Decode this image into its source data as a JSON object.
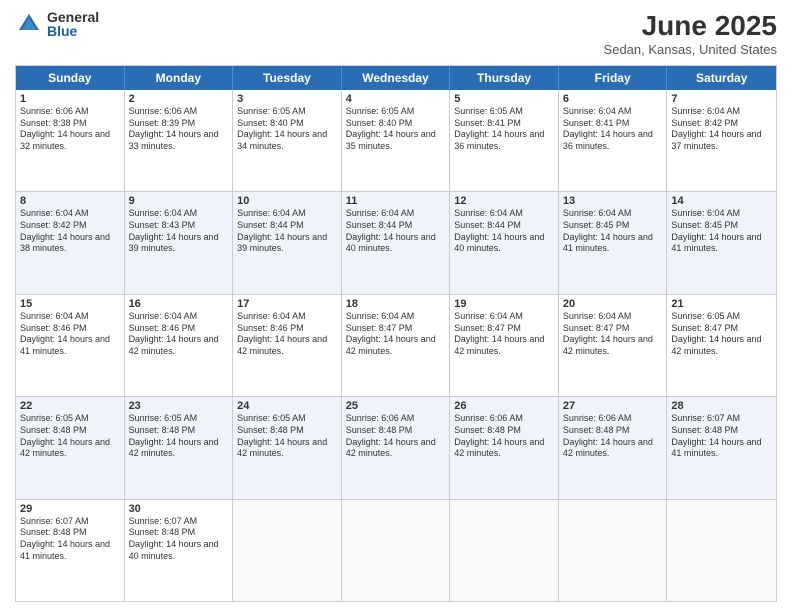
{
  "logo": {
    "general": "General",
    "blue": "Blue"
  },
  "title": "June 2025",
  "location": "Sedan, Kansas, United States",
  "weekdays": [
    "Sunday",
    "Monday",
    "Tuesday",
    "Wednesday",
    "Thursday",
    "Friday",
    "Saturday"
  ],
  "rows": [
    {
      "alt": false,
      "cells": [
        {
          "day": "1",
          "sunrise": "Sunrise: 6:06 AM",
          "sunset": "Sunset: 8:38 PM",
          "daylight": "Daylight: 14 hours and 32 minutes."
        },
        {
          "day": "2",
          "sunrise": "Sunrise: 6:06 AM",
          "sunset": "Sunset: 8:39 PM",
          "daylight": "Daylight: 14 hours and 33 minutes."
        },
        {
          "day": "3",
          "sunrise": "Sunrise: 6:05 AM",
          "sunset": "Sunset: 8:40 PM",
          "daylight": "Daylight: 14 hours and 34 minutes."
        },
        {
          "day": "4",
          "sunrise": "Sunrise: 6:05 AM",
          "sunset": "Sunset: 8:40 PM",
          "daylight": "Daylight: 14 hours and 35 minutes."
        },
        {
          "day": "5",
          "sunrise": "Sunrise: 6:05 AM",
          "sunset": "Sunset: 8:41 PM",
          "daylight": "Daylight: 14 hours and 36 minutes."
        },
        {
          "day": "6",
          "sunrise": "Sunrise: 6:04 AM",
          "sunset": "Sunset: 8:41 PM",
          "daylight": "Daylight: 14 hours and 36 minutes."
        },
        {
          "day": "7",
          "sunrise": "Sunrise: 6:04 AM",
          "sunset": "Sunset: 8:42 PM",
          "daylight": "Daylight: 14 hours and 37 minutes."
        }
      ]
    },
    {
      "alt": true,
      "cells": [
        {
          "day": "8",
          "sunrise": "Sunrise: 6:04 AM",
          "sunset": "Sunset: 8:42 PM",
          "daylight": "Daylight: 14 hours and 38 minutes."
        },
        {
          "day": "9",
          "sunrise": "Sunrise: 6:04 AM",
          "sunset": "Sunset: 8:43 PM",
          "daylight": "Daylight: 14 hours and 39 minutes."
        },
        {
          "day": "10",
          "sunrise": "Sunrise: 6:04 AM",
          "sunset": "Sunset: 8:44 PM",
          "daylight": "Daylight: 14 hours and 39 minutes."
        },
        {
          "day": "11",
          "sunrise": "Sunrise: 6:04 AM",
          "sunset": "Sunset: 8:44 PM",
          "daylight": "Daylight: 14 hours and 40 minutes."
        },
        {
          "day": "12",
          "sunrise": "Sunrise: 6:04 AM",
          "sunset": "Sunset: 8:44 PM",
          "daylight": "Daylight: 14 hours and 40 minutes."
        },
        {
          "day": "13",
          "sunrise": "Sunrise: 6:04 AM",
          "sunset": "Sunset: 8:45 PM",
          "daylight": "Daylight: 14 hours and 41 minutes."
        },
        {
          "day": "14",
          "sunrise": "Sunrise: 6:04 AM",
          "sunset": "Sunset: 8:45 PM",
          "daylight": "Daylight: 14 hours and 41 minutes."
        }
      ]
    },
    {
      "alt": false,
      "cells": [
        {
          "day": "15",
          "sunrise": "Sunrise: 6:04 AM",
          "sunset": "Sunset: 8:46 PM",
          "daylight": "Daylight: 14 hours and 41 minutes."
        },
        {
          "day": "16",
          "sunrise": "Sunrise: 6:04 AM",
          "sunset": "Sunset: 8:46 PM",
          "daylight": "Daylight: 14 hours and 42 minutes."
        },
        {
          "day": "17",
          "sunrise": "Sunrise: 6:04 AM",
          "sunset": "Sunset: 8:46 PM",
          "daylight": "Daylight: 14 hours and 42 minutes."
        },
        {
          "day": "18",
          "sunrise": "Sunrise: 6:04 AM",
          "sunset": "Sunset: 8:47 PM",
          "daylight": "Daylight: 14 hours and 42 minutes."
        },
        {
          "day": "19",
          "sunrise": "Sunrise: 6:04 AM",
          "sunset": "Sunset: 8:47 PM",
          "daylight": "Daylight: 14 hours and 42 minutes."
        },
        {
          "day": "20",
          "sunrise": "Sunrise: 6:04 AM",
          "sunset": "Sunset: 8:47 PM",
          "daylight": "Daylight: 14 hours and 42 minutes."
        },
        {
          "day": "21",
          "sunrise": "Sunrise: 6:05 AM",
          "sunset": "Sunset: 8:47 PM",
          "daylight": "Daylight: 14 hours and 42 minutes."
        }
      ]
    },
    {
      "alt": true,
      "cells": [
        {
          "day": "22",
          "sunrise": "Sunrise: 6:05 AM",
          "sunset": "Sunset: 8:48 PM",
          "daylight": "Daylight: 14 hours and 42 minutes."
        },
        {
          "day": "23",
          "sunrise": "Sunrise: 6:05 AM",
          "sunset": "Sunset: 8:48 PM",
          "daylight": "Daylight: 14 hours and 42 minutes."
        },
        {
          "day": "24",
          "sunrise": "Sunrise: 6:05 AM",
          "sunset": "Sunset: 8:48 PM",
          "daylight": "Daylight: 14 hours and 42 minutes."
        },
        {
          "day": "25",
          "sunrise": "Sunrise: 6:06 AM",
          "sunset": "Sunset: 8:48 PM",
          "daylight": "Daylight: 14 hours and 42 minutes."
        },
        {
          "day": "26",
          "sunrise": "Sunrise: 6:06 AM",
          "sunset": "Sunset: 8:48 PM",
          "daylight": "Daylight: 14 hours and 42 minutes."
        },
        {
          "day": "27",
          "sunrise": "Sunrise: 6:06 AM",
          "sunset": "Sunset: 8:48 PM",
          "daylight": "Daylight: 14 hours and 42 minutes."
        },
        {
          "day": "28",
          "sunrise": "Sunrise: 6:07 AM",
          "sunset": "Sunset: 8:48 PM",
          "daylight": "Daylight: 14 hours and 41 minutes."
        }
      ]
    },
    {
      "alt": false,
      "cells": [
        {
          "day": "29",
          "sunrise": "Sunrise: 6:07 AM",
          "sunset": "Sunset: 8:48 PM",
          "daylight": "Daylight: 14 hours and 41 minutes."
        },
        {
          "day": "30",
          "sunrise": "Sunrise: 6:07 AM",
          "sunset": "Sunset: 8:48 PM",
          "daylight": "Daylight: 14 hours and 40 minutes."
        },
        {
          "day": "",
          "sunrise": "",
          "sunset": "",
          "daylight": ""
        },
        {
          "day": "",
          "sunrise": "",
          "sunset": "",
          "daylight": ""
        },
        {
          "day": "",
          "sunrise": "",
          "sunset": "",
          "daylight": ""
        },
        {
          "day": "",
          "sunrise": "",
          "sunset": "",
          "daylight": ""
        },
        {
          "day": "",
          "sunrise": "",
          "sunset": "",
          "daylight": ""
        }
      ]
    }
  ]
}
